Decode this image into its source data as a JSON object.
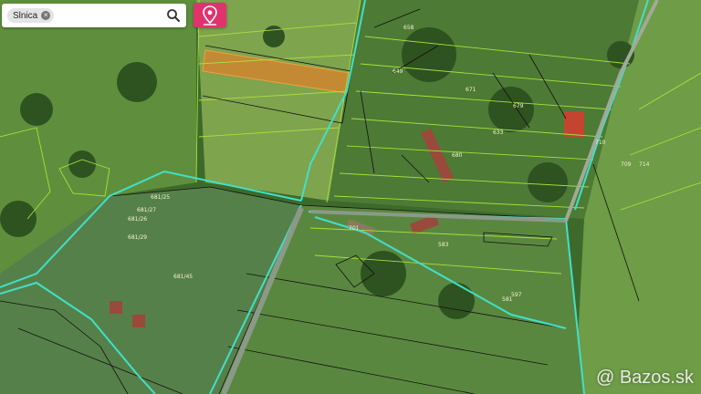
{
  "search": {
    "chip_label": "Slnica",
    "chip_remove": "×"
  },
  "watermark": "@ Bazos.sk",
  "colors": {
    "highlight": "#d9822b",
    "cadastre_line": "#a8e03a",
    "road_line": "#40e0c8",
    "pin_button": "#e0336e"
  },
  "icons": {
    "search": "search-icon",
    "pin": "map-pin-icon",
    "chip_close": "close-icon"
  },
  "parcel_labels": [
    "709",
    "681/25",
    "681/27",
    "681/26",
    "681/29",
    "681/45",
    "671",
    "679",
    "680",
    "658",
    "649",
    "633",
    "710",
    "714",
    "701",
    "581",
    "583",
    "597"
  ]
}
